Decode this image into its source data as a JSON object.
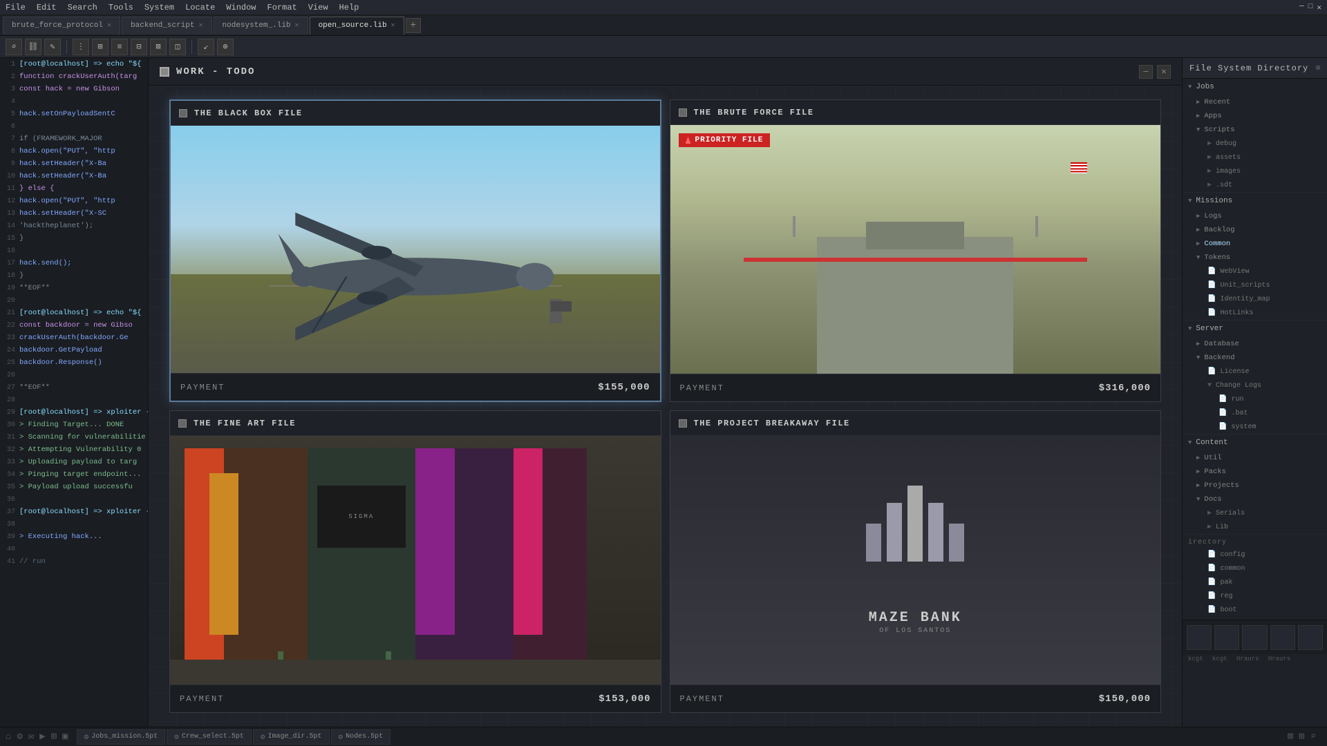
{
  "menuBar": {
    "items": [
      "File",
      "Edit",
      "Search",
      "Tools",
      "System",
      "Locate",
      "Window",
      "Format",
      "View",
      "Help"
    ],
    "winControls": [
      "─",
      "□",
      "✕"
    ]
  },
  "tabs": [
    {
      "label": "brute_force_protocol",
      "active": false
    },
    {
      "label": "backend_script",
      "active": false
    },
    {
      "label": "nodesystem_.lib",
      "active": false
    },
    {
      "label": "open_source.lib",
      "active": true
    }
  ],
  "workHeader": {
    "title": "WORK - TODO",
    "icon": "□"
  },
  "missions": [
    {
      "id": "black-box",
      "title": "THE BLACK BOX FILE",
      "payment": "PAYMENT",
      "amount": "$155,000",
      "scene": "airplane",
      "selected": true
    },
    {
      "id": "brute-force",
      "title": "THE BRUTE FORCE FILE",
      "payment": "PAYMENT",
      "amount": "$316,000",
      "scene": "checkpoint",
      "priority": true,
      "priorityLabel": "PRIORITY FILE",
      "selected": false
    },
    {
      "id": "fine-art",
      "title": "THE FINE ART FILE",
      "payment": "PAYMENT",
      "amount": "$153,000",
      "scene": "shopping",
      "selected": false
    },
    {
      "id": "project-breakaway",
      "title": "THE PROJECT BREAKAWAY FILE",
      "payment": "PAYMENT",
      "amount": "$150,000",
      "scene": "mazebank",
      "selected": false
    }
  ],
  "rightPanel": {
    "title": "File System Directory",
    "sections": [
      {
        "label": "Jobs",
        "items": [
          {
            "label": "Recent",
            "icon": "folder",
            "indent": 1
          },
          {
            "label": "Apps",
            "icon": "folder",
            "indent": 1
          },
          {
            "label": "Scripts",
            "icon": "folder",
            "indent": 1,
            "children": [
              {
                "label": "debug",
                "icon": "folder"
              },
              {
                "label": "assets",
                "icon": "folder"
              },
              {
                "label": "images",
                "icon": "folder"
              },
              {
                "label": ".sdt",
                "icon": "folder"
              }
            ]
          }
        ]
      },
      {
        "label": "Missions",
        "items": [
          {
            "label": "Logs",
            "icon": "folder",
            "indent": 1
          },
          {
            "label": "Backlog",
            "icon": "folder",
            "indent": 1
          },
          {
            "label": "Common",
            "icon": "folder",
            "indent": 1,
            "selected": true
          },
          {
            "label": "Tokens",
            "icon": "folder",
            "indent": 1,
            "children": [
              {
                "label": "WebView",
                "icon": "file"
              },
              {
                "label": "Unit_scripts",
                "icon": "file"
              },
              {
                "label": "Identity_map",
                "icon": "file"
              },
              {
                "label": "HotLinks",
                "icon": "file"
              }
            ]
          }
        ]
      },
      {
        "label": "Server",
        "items": [
          {
            "label": "Database",
            "icon": "folder",
            "indent": 1
          },
          {
            "label": "Backend",
            "icon": "folder",
            "indent": 1,
            "children": [
              {
                "label": "License",
                "icon": "file"
              },
              {
                "label": "Change Logs",
                "icon": "folder",
                "children": [
                  {
                    "label": "run",
                    "icon": "file",
                    "deep": true
                  },
                  {
                    "label": ".bat",
                    "icon": "file",
                    "deep": true
                  },
                  {
                    "label": "system",
                    "icon": "file",
                    "deep": true
                  }
                ]
              }
            ]
          }
        ]
      },
      {
        "label": "Content",
        "items": [
          {
            "label": "Util",
            "icon": "folder",
            "indent": 1
          },
          {
            "label": "Packs",
            "icon": "folder",
            "indent": 1
          },
          {
            "label": "Projects",
            "icon": "folder",
            "indent": 1
          },
          {
            "label": "Docs",
            "icon": "folder",
            "indent": 1,
            "children": [
              {
                "label": "Serials",
                "icon": "folder"
              },
              {
                "label": "Lib",
                "icon": "folder"
              }
            ]
          },
          {
            "label": "config",
            "icon": "file",
            "indent": 2
          },
          {
            "label": "common",
            "icon": "file",
            "indent": 2
          },
          {
            "label": "pak",
            "icon": "file",
            "indent": 2
          },
          {
            "label": "reg",
            "icon": "file",
            "indent": 2
          },
          {
            "label": "boot",
            "icon": "file",
            "indent": 2
          }
        ]
      }
    ]
  },
  "statusBar": {
    "tabs": [
      {
        "icon": "⚙",
        "label": "Jobs_mission.5pt"
      },
      {
        "icon": "⚙",
        "label": "Crew_select.5pt"
      },
      {
        "icon": "⚙",
        "label": "Image_dir.5pt"
      },
      {
        "icon": "⚙",
        "label": "Nodes.5pt"
      }
    ]
  },
  "codeLines": [
    {
      "num": 1,
      "content": "[root@localhost] => echo \"${"
    },
    {
      "num": 2,
      "content": "function crackUserAuth(targ"
    },
    {
      "num": 3,
      "content": "  const hack = new Gibson"
    },
    {
      "num": 4,
      "content": ""
    },
    {
      "num": 5,
      "content": "hack.setOnPayloadSentC"
    },
    {
      "num": 6,
      "content": ""
    },
    {
      "num": 7,
      "content": "  if (FRAMEWORK_MAJOR"
    },
    {
      "num": 8,
      "content": "    hack.open(\"PUT\", \"http"
    },
    {
      "num": 9,
      "content": "    hack.setHeader(\"X-Ba"
    },
    {
      "num": 10,
      "content": "    hack.setHeader(\"X-Ba"
    },
    {
      "num": 11,
      "content": "  } else {"
    },
    {
      "num": 12,
      "content": "    hack.open(\"PUT\", \"http"
    },
    {
      "num": 13,
      "content": "    hack.setHeader(\"X-SC"
    },
    {
      "num": 14,
      "content": "    'hacktheplanet');"
    },
    {
      "num": 15,
      "content": "  }"
    },
    {
      "num": 16,
      "content": ""
    },
    {
      "num": 17,
      "content": "  hack.send();"
    },
    {
      "num": 18,
      "content": "}"
    },
    {
      "num": 19,
      "content": "**EOF**"
    },
    {
      "num": 20,
      "content": ""
    },
    {
      "num": 21,
      "content": "[root@localhost] => echo \"${"
    },
    {
      "num": 22,
      "content": "const backdoor = new Gibso"
    },
    {
      "num": 23,
      "content": "crackUserAuth(backdoor.Ge"
    },
    {
      "num": 24,
      "content": "    backdoor.GetPayload"
    },
    {
      "num": 25,
      "content": "    backdoor.Response()"
    },
    {
      "num": 26,
      "content": ""
    },
    {
      "num": 27,
      "content": "**EOF**"
    },
    {
      "num": 28,
      "content": ""
    },
    {
      "num": 29,
      "content": "[root@localhost] => xploiter -"
    },
    {
      "num": 30,
      "content": "> Finding Target... DONE"
    },
    {
      "num": 31,
      "content": "> Scanning for vulnerabilitie"
    },
    {
      "num": 32,
      "content": "> Attempting Vulnerability 0"
    },
    {
      "num": 33,
      "content": "> Uploading payload to targ"
    },
    {
      "num": 34,
      "content": "> Pinging target endpoint..."
    },
    {
      "num": 35,
      "content": "> Payload upload successfu"
    },
    {
      "num": 36,
      "content": ""
    },
    {
      "num": 37,
      "content": "[root@localhost] => xploiter -"
    },
    {
      "num": 38,
      "content": ""
    },
    {
      "num": 39,
      "content": "> Executing hack..."
    },
    {
      "num": 40,
      "content": ""
    },
    {
      "num": 41,
      "content": "// run"
    }
  ],
  "mazebankLogo": {
    "name": "MAZE BANK",
    "subtitle": "OF LOS SANTOS",
    "bars": [
      60,
      90,
      110,
      90,
      60
    ]
  }
}
